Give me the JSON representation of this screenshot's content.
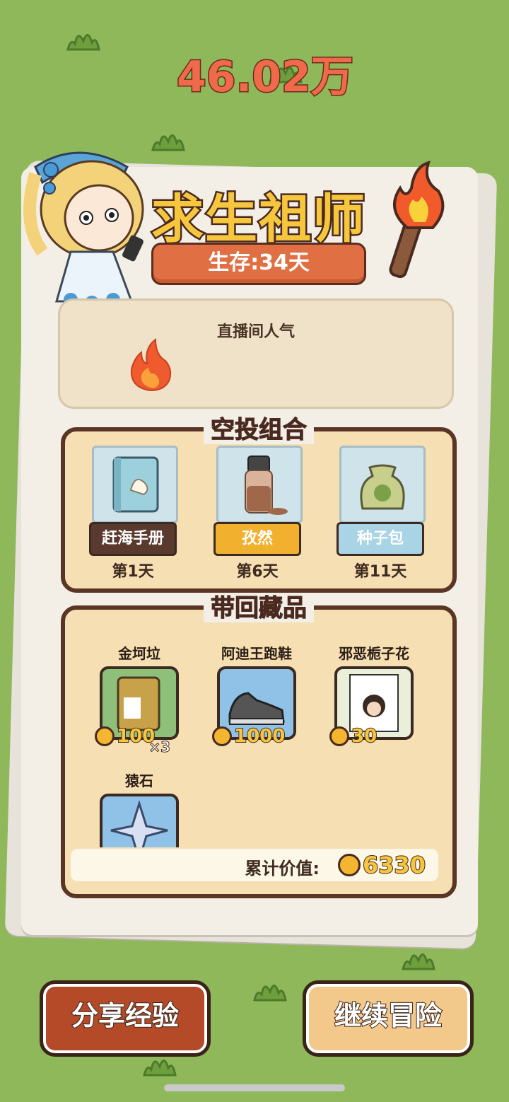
{
  "title": "求生祖师",
  "survival": {
    "text": "生存:34天"
  },
  "popularity": {
    "label": "直播间人气",
    "value": "46.02万"
  },
  "airdrop": {
    "title": "空投组合",
    "items": [
      {
        "name": "赶海手册",
        "day": "第1天",
        "icon": "book-icon",
        "color": "#5a3a2e"
      },
      {
        "name": "孜然",
        "day": "第6天",
        "icon": "spice-jar-icon",
        "color": "#f1b02e"
      },
      {
        "name": "种子包",
        "day": "第11天",
        "icon": "seed-bag-icon",
        "color": "#a8d4e6"
      }
    ]
  },
  "collection": {
    "title": "带回藏品",
    "items": [
      {
        "name": "金坷垃",
        "price": "100",
        "qty": "×3",
        "icon": "fertilizer-bag-icon",
        "card_color": "#8fc07a"
      },
      {
        "name": "阿迪王跑鞋",
        "price": "1000",
        "qty": "",
        "icon": "sneaker-icon",
        "card_color": "#8fc2e6"
      },
      {
        "name": "邪恶栀子花",
        "price": "30",
        "qty": "",
        "icon": "poster-icon",
        "card_color": "#e9efd9"
      },
      {
        "name": "猿石",
        "price": "",
        "qty": "",
        "icon": "star-crystal-icon",
        "card_color": "#8fc2e6"
      }
    ],
    "total_label": "累计价值:",
    "total_value": "6330"
  },
  "buttons": {
    "share": "分享经验",
    "continue": "继续冒险"
  },
  "colors": {
    "background": "#8fb85a",
    "accent": "#e07043",
    "gold": "#f6c63d"
  }
}
